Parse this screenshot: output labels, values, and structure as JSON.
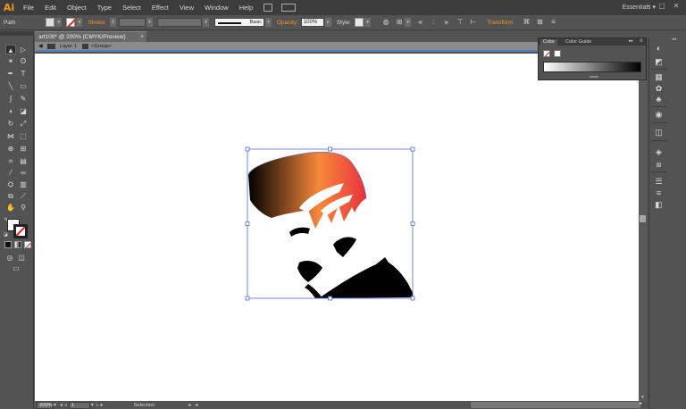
{
  "app": {
    "logo": "Ai"
  },
  "menu": {
    "items": [
      "File",
      "Edit",
      "Object",
      "Type",
      "Select",
      "Effect",
      "View",
      "Window",
      "Help"
    ],
    "workspace": "Essentials ▾"
  },
  "control_bar": {
    "selection_type": "Path",
    "stroke_label": "Stroke:",
    "brush_label": "Basic",
    "opacity_label": "Opacity:",
    "opacity_value": "100%",
    "style_label": "Style:",
    "transform_label": "Transform"
  },
  "document": {
    "tab_title": "art100* @ 200% (CMYK/Preview)",
    "close": "×",
    "layer_label": "Layer 1",
    "group_label": "<Group>"
  },
  "status": {
    "zoom": "200%",
    "artboard_number": "1",
    "tool_name": "Selection"
  },
  "color_panel": {
    "tab_color": "Color",
    "tab_guide": "Color Guide",
    "panel_menu": "≡"
  },
  "artwork": {
    "gradient_colors": [
      "#000000",
      "#f7893b",
      "#e8323c"
    ],
    "selection_color": "#4a6fd6"
  },
  "tools": [
    {
      "name": "selection-tool",
      "icon": "▲"
    },
    {
      "name": "direct-selection-tool",
      "icon": "▷"
    },
    {
      "name": "magic-wand-tool",
      "icon": "✶"
    },
    {
      "name": "lasso-tool",
      "icon": "ʘ"
    },
    {
      "name": "pen-tool",
      "icon": "✒"
    },
    {
      "name": "type-tool",
      "icon": "T"
    },
    {
      "name": "line-tool",
      "icon": "╲"
    },
    {
      "name": "rectangle-tool",
      "icon": "▭"
    },
    {
      "name": "paintbrush-tool",
      "icon": "∫"
    },
    {
      "name": "pencil-tool",
      "icon": "✎"
    },
    {
      "name": "blob-brush-tool",
      "icon": "◖"
    },
    {
      "name": "eraser-tool",
      "icon": "◪"
    },
    {
      "name": "rotate-tool",
      "icon": "↻"
    },
    {
      "name": "scale-tool",
      "icon": "⤢"
    },
    {
      "name": "width-tool",
      "icon": "⋈"
    },
    {
      "name": "free-transform-tool",
      "icon": "⬚"
    },
    {
      "name": "shape-builder-tool",
      "icon": "⊕"
    },
    {
      "name": "perspective-grid-tool",
      "icon": "⊞"
    },
    {
      "name": "mesh-tool",
      "icon": "⌗"
    },
    {
      "name": "gradient-tool",
      "icon": "▤"
    },
    {
      "name": "eyedropper-tool",
      "icon": "⁄"
    },
    {
      "name": "blend-tool",
      "icon": "∞"
    },
    {
      "name": "symbol-sprayer-tool",
      "icon": "⛭"
    },
    {
      "name": "column-graph-tool",
      "icon": "▥"
    },
    {
      "name": "artboard-tool",
      "icon": "⧉"
    },
    {
      "name": "slice-tool",
      "icon": "⟋"
    },
    {
      "name": "hand-tool",
      "icon": "✋"
    },
    {
      "name": "zoom-tool",
      "icon": "⚲"
    }
  ],
  "dock": [
    {
      "name": "color-panel-icon",
      "icon": "◐"
    },
    {
      "name": "color-guide-panel-icon",
      "icon": "◩"
    },
    {
      "name": "swatches-panel-icon",
      "icon": "▦"
    },
    {
      "name": "brushes-panel-icon",
      "icon": "✿"
    },
    {
      "name": "symbols-panel-icon",
      "icon": "♣"
    },
    {
      "name": "graphic-styles-panel-icon",
      "icon": "◉"
    },
    {
      "name": "appearance-panel-icon",
      "icon": "◫"
    },
    {
      "name": "layers-panel-icon",
      "icon": "◈"
    },
    {
      "name": "artboards-panel-icon",
      "icon": "⧈"
    },
    {
      "name": "align-panel-icon",
      "icon": "☰"
    },
    {
      "name": "stroke-panel-icon",
      "icon": "≡"
    },
    {
      "name": "transparency-panel-icon",
      "icon": "◧"
    }
  ]
}
